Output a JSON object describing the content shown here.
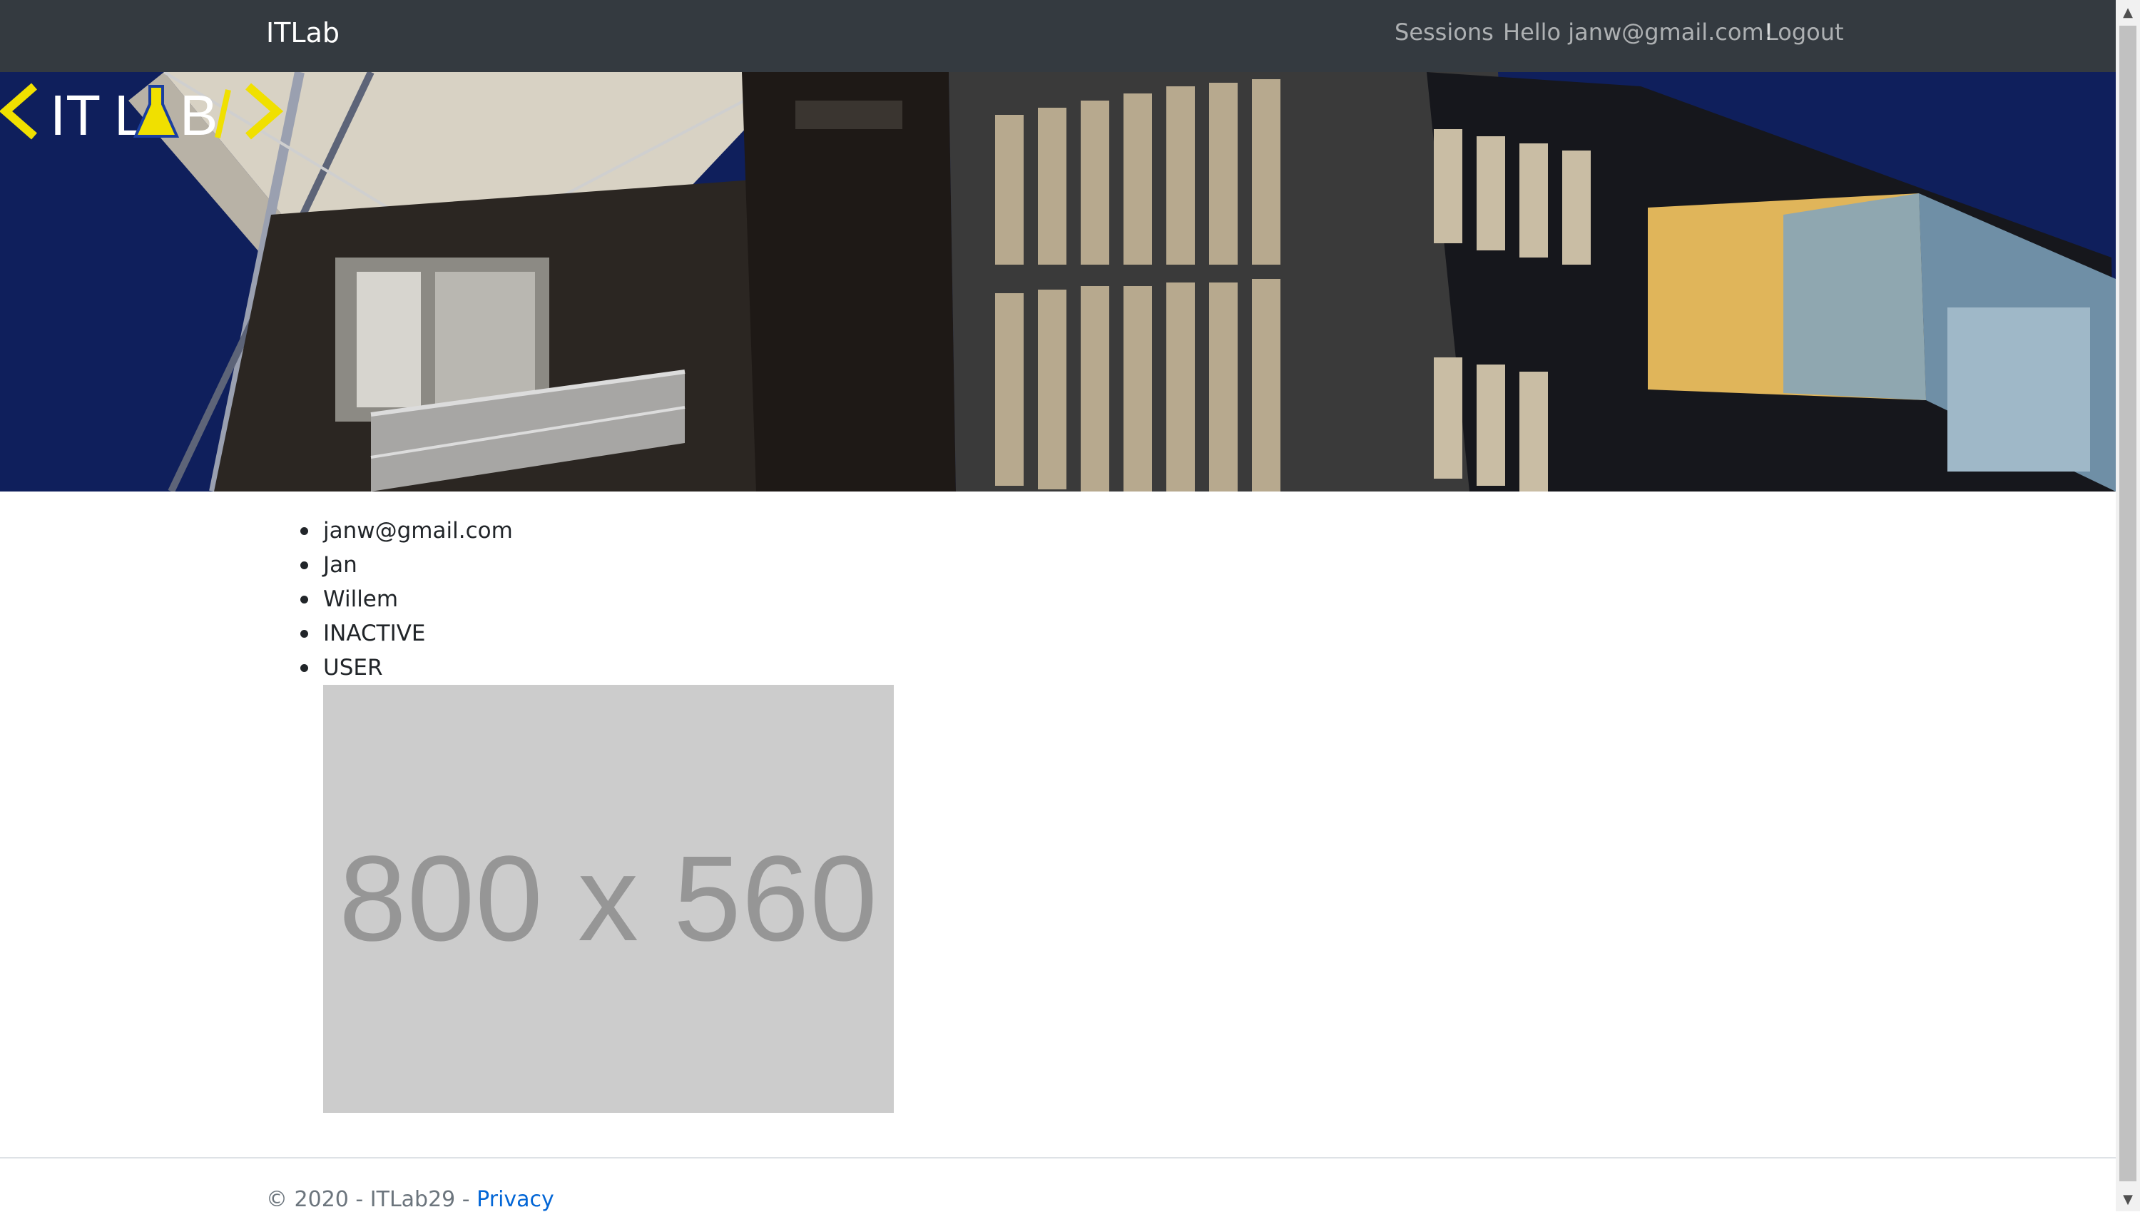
{
  "navbar": {
    "brand": "ITLab",
    "links": {
      "sessions": "Sessions",
      "hello": "Hello janw@gmail.com!",
      "logout": "Logout"
    }
  },
  "hero": {
    "logo_text": "< IT LAB />",
    "image_alt": "Building facade at night"
  },
  "profile": {
    "items": [
      "janw@gmail.com",
      "Jan",
      "Willem",
      "INACTIVE",
      "USER"
    ],
    "placeholder_label": "800 x 560"
  },
  "footer": {
    "copyright": "© 2020 - ITLab29 - ",
    "privacy_link": "Privacy"
  },
  "colors": {
    "navbar_bg": "#343a40",
    "link": "#0366d6",
    "logo_accent": "#f0e000",
    "placeholder_bg": "#cccccc"
  }
}
